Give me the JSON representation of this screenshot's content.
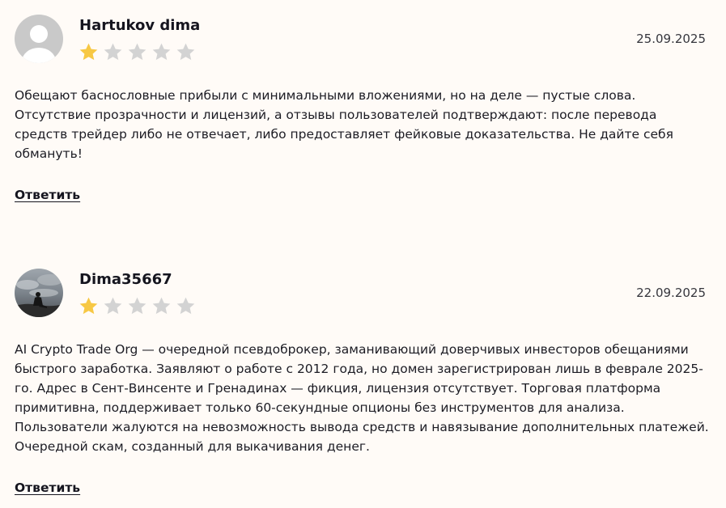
{
  "colors": {
    "background": "#fffbf7",
    "star_filled": "#f7c844",
    "star_empty": "#d3d3d3",
    "text": "#1c1c24"
  },
  "reviews": [
    {
      "author": "Hartukov dima",
      "avatar": "default-user-avatar",
      "rating": 1,
      "max_rating": 5,
      "date": "25.09.2025",
      "text": "Обещают баснословные прибыли с минимальными вложениями, но на деле — пустые слова. Отсутствие прозрачности и лицензий, а отзывы пользователей подтверждают: после перевода средств трейдер либо не отвечает, либо предоставляет фейковые доказательства. Не дайте себя обмануть!",
      "reply_label": "Ответить"
    },
    {
      "author": "Dima35667",
      "avatar": "photo-avatar",
      "rating": 1,
      "max_rating": 5,
      "date": "22.09.2025",
      "text": "AI Crypto Trade Org — очередной псевдоброкер, заманивающий доверчивых инвесторов обещаниями быстрого заработка. Заявляют о работе с 2012 года, но домен зарегистрирован лишь в феврале 2025-го. Адрес в Сент-Винсенте и Гренадинах — фикция, лицензия отсутствует. Торговая платформа примитивна, поддерживает только 60-секундные опционы без инструментов для анализа. Пользователи жалуются на невозможность вывода средств и навязывание дополнительных платежей. Очередной скам, созданный для выкачивания денег.",
      "reply_label": "Ответить"
    }
  ]
}
